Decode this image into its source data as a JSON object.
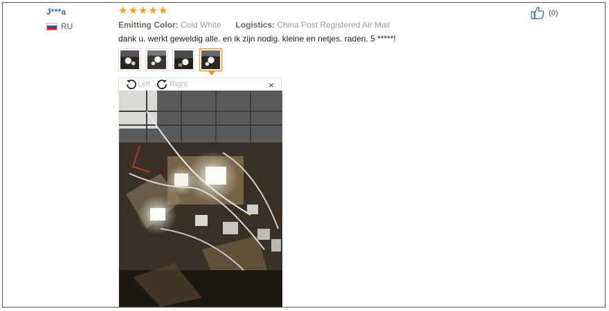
{
  "review": {
    "user": "J***a",
    "country": "RU",
    "rating": 5,
    "emitting_label": "Emitting Color:",
    "emitting_value": "Cold White",
    "logistics_label": "Logistics:",
    "logistics_value": "China Post Registered Air Mail",
    "text": "dank u. werkt geweldig alle. en ik zijn nodig. kleine en netjes. raden. 5 *****!",
    "likes": "(0)"
  },
  "viewer": {
    "rotate_left": "Left",
    "rotate_right": "Right",
    "close": "×"
  },
  "icons": {
    "star": "star-icon",
    "thumbs_up": "thumbs-up-icon",
    "rotate_left": "rotate-left-icon",
    "rotate_right": "rotate-right-icon",
    "close": "close-icon"
  },
  "colors": {
    "star": "#f7a11a",
    "user_link": "#2a6bb1",
    "active_thumb": "#f08a1c"
  }
}
